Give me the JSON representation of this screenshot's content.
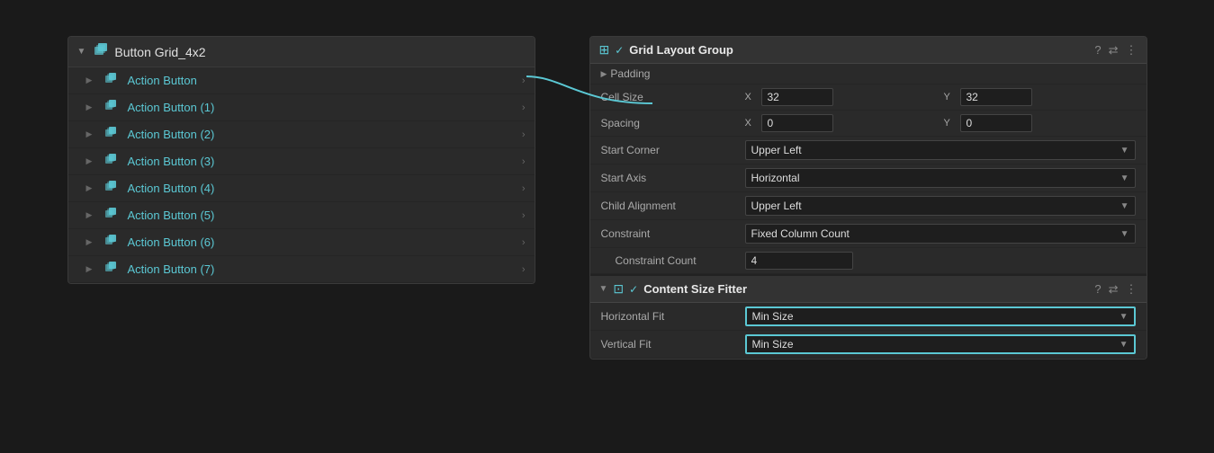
{
  "hierarchy": {
    "header": {
      "title": "Button Grid_4x2"
    },
    "items": [
      {
        "label": "Action Button",
        "id": 0
      },
      {
        "label": "Action Button (1)",
        "id": 1
      },
      {
        "label": "Action Button (2)",
        "id": 2
      },
      {
        "label": "Action Button (3)",
        "id": 3
      },
      {
        "label": "Action Button (4)",
        "id": 4
      },
      {
        "label": "Action Button (5)",
        "id": 5
      },
      {
        "label": "Action Button (6)",
        "id": 6
      },
      {
        "label": "Action Button (7)",
        "id": 7
      }
    ]
  },
  "gridLayoutGroup": {
    "title": "Grid Layout Group",
    "padding_label": "Padding",
    "cell_size_label": "Cell Size",
    "cell_size_x": "32",
    "cell_size_y": "32",
    "spacing_label": "Spacing",
    "spacing_x": "0",
    "spacing_y": "0",
    "start_corner_label": "Start Corner",
    "start_corner_value": "Upper Left",
    "start_axis_label": "Start Axis",
    "start_axis_value": "Horizontal",
    "child_alignment_label": "Child Alignment",
    "child_alignment_value": "Upper Left",
    "constraint_label": "Constraint",
    "constraint_value": "Fixed Column Count",
    "constraint_count_label": "Constraint Count",
    "constraint_count_value": "4"
  },
  "contentSizeFitter": {
    "title": "Content Size Fitter",
    "horizontal_fit_label": "Horizontal Fit",
    "horizontal_fit_value": "Min Size",
    "vertical_fit_label": "Vertical Fit",
    "vertical_fit_value": "Min Size"
  },
  "icons": {
    "question": "?",
    "settings": "⚙",
    "menu": "⋮",
    "chevron_right": "▶",
    "chevron_down": "▼",
    "check": "✓",
    "arrow_right": "›"
  }
}
